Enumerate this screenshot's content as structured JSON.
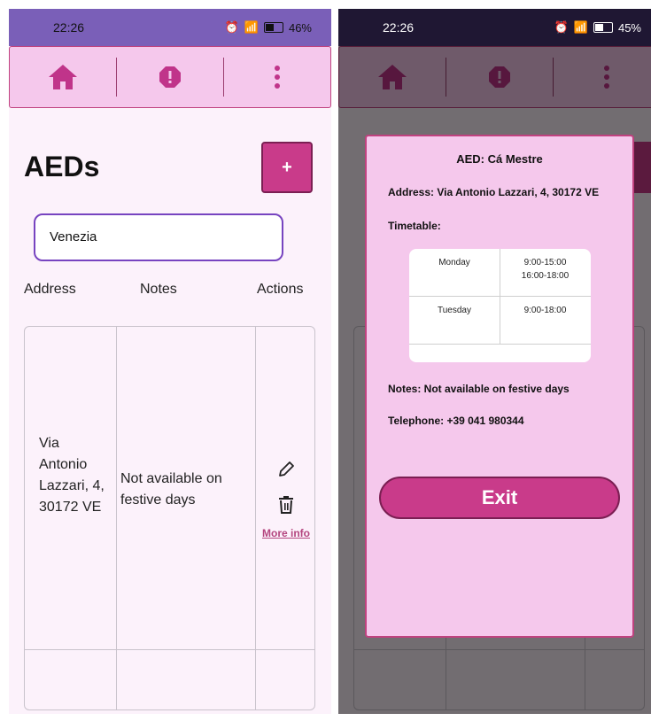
{
  "left_screen": {
    "status": {
      "time": "22:26",
      "battery": "46%"
    },
    "title": "AEDs",
    "add_label": "+",
    "search": {
      "value": "Venezia"
    },
    "columns": [
      "Address",
      "Notes",
      "Actions"
    ],
    "row": {
      "address": "Via Antonio Lazzari, 4, 30172 VE",
      "notes": "Not available on festive days",
      "more_info": "More info"
    }
  },
  "right_screen": {
    "status": {
      "time": "22:26",
      "battery": "45%"
    },
    "modal": {
      "title": "AED: Cá Mestre",
      "address": "Address: Via Antonio Lazzari, 4, 30172 VE",
      "timetable_label": "Timetable:",
      "timetable": [
        {
          "day": "Monday",
          "hours_1": "9:00-15:00",
          "hours_2": "16:00-18:00"
        },
        {
          "day": "Tuesday",
          "hours_1": "9:00-18:00",
          "hours_2": ""
        }
      ],
      "notes": "Notes: Not available on festive days",
      "telephone": "Telephone: +39 041 980344",
      "exit_label": "Exit"
    }
  },
  "colors": {
    "accent": "#c93b8a",
    "nav_bg": "#f5c8ec",
    "input_border": "#7744c0"
  }
}
